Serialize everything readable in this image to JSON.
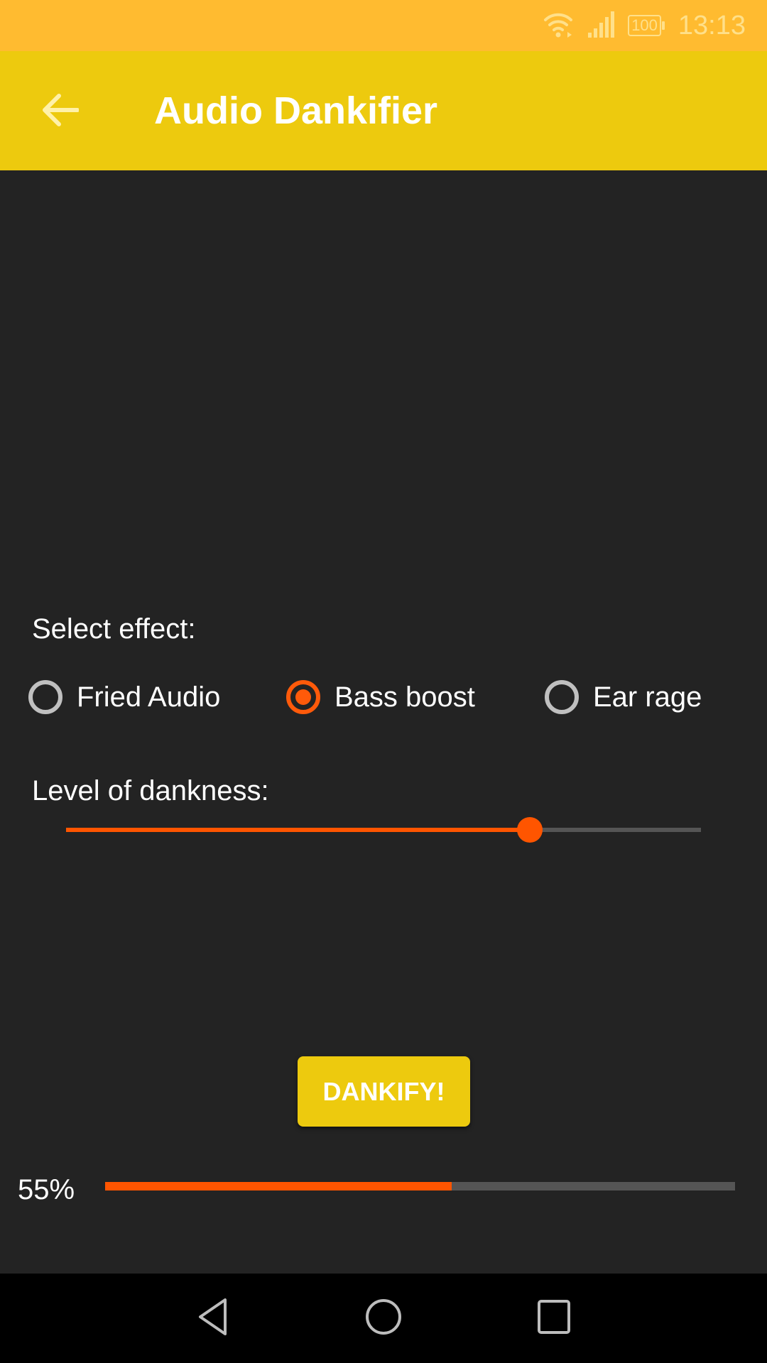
{
  "status_bar": {
    "time": "13:13",
    "battery_level": "100",
    "icons": [
      "wifi-icon",
      "signal-icon",
      "battery-icon"
    ]
  },
  "app_bar": {
    "title": "Audio Dankifier",
    "back_icon": "arrow-left-icon"
  },
  "effect": {
    "label": "Select effect:",
    "options": [
      {
        "label": "Fried Audio",
        "checked": false
      },
      {
        "label": "Bass boost",
        "checked": true
      },
      {
        "label": "Ear rage",
        "checked": false
      }
    ],
    "selected": "Bass boost"
  },
  "dankness": {
    "label": "Level of dankness:",
    "value_fraction": 0.73
  },
  "action": {
    "button_label": "DANKIFY!"
  },
  "progress": {
    "label": "55%",
    "value_fraction": 0.55
  },
  "nav_bar": {
    "icons": [
      "back-triangle-icon",
      "home-circle-icon",
      "recents-square-icon"
    ]
  },
  "colors": {
    "status_bar": "#FFBB30",
    "app_bar": "#EDCA0E",
    "background": "#232323",
    "accent": "#FF5500",
    "track": "#555555"
  }
}
